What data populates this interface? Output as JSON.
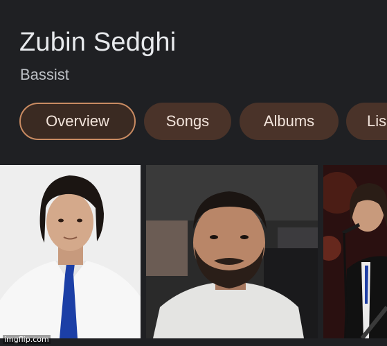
{
  "header": {
    "title": "Zubin Sedghi",
    "subtitle": "Bassist"
  },
  "tabs": [
    {
      "label": "Overview",
      "active": true
    },
    {
      "label": "Songs",
      "active": false
    },
    {
      "label": "Albums",
      "active": false
    },
    {
      "label": "Lis",
      "active": false
    }
  ],
  "images": [
    {
      "icon": "portrait-photo-1"
    },
    {
      "icon": "portrait-photo-2"
    },
    {
      "icon": "concert-photo-3"
    }
  ],
  "watermark": "imgflip.com",
  "colors": {
    "background": "#202124",
    "tab_fill": "#4a3329",
    "tab_active_border": "#c98b62",
    "text_primary": "#e8eaed"
  }
}
